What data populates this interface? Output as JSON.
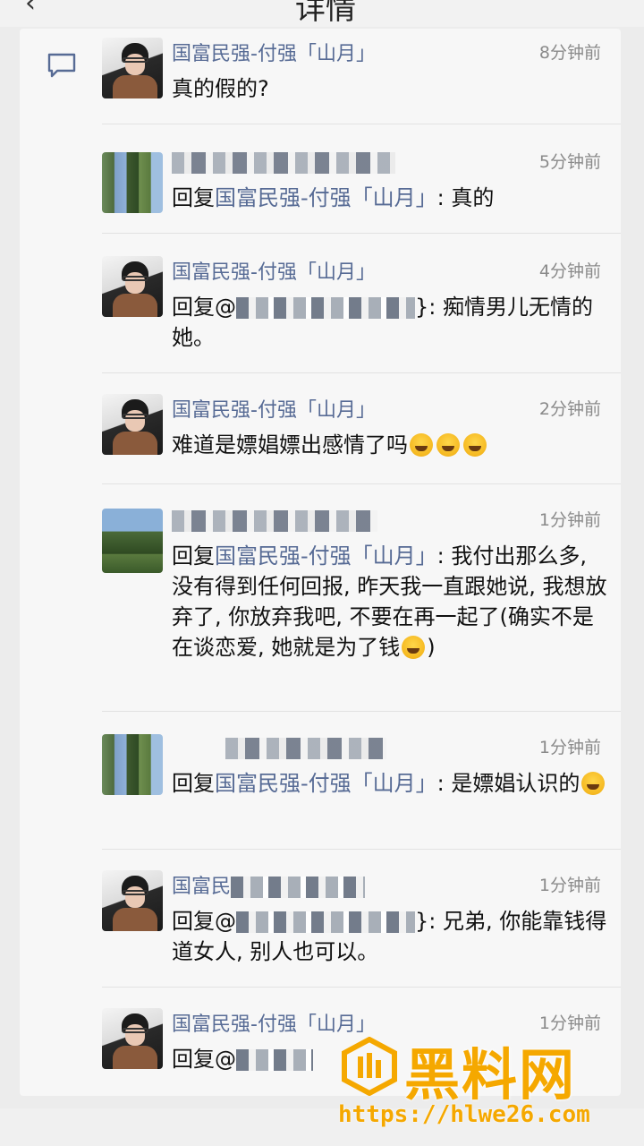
{
  "header": {
    "back_icon": "chevron-left-icon",
    "title": "详情"
  },
  "comments": [
    {
      "author": "国富民强-付强「山月」",
      "time": "8分钟前",
      "text": "真的假的?",
      "avatar": "person-avatar"
    },
    {
      "author": "",
      "time": "5分钟前",
      "reply_prefix": "回复",
      "reply_target": "国富民强-付强「山月」",
      "text": ": 真的",
      "avatar": "blurred-avatar"
    },
    {
      "author": "国富民强-付强「山月」",
      "time": "4分钟前",
      "reply_prefix": "回复@",
      "text": "}: 痴情男儿无情的她。",
      "avatar": "person-avatar"
    },
    {
      "author": "国富民强-付强「山月」",
      "time": "2分钟前",
      "text": "难道是嫖娼嫖出感情了吗",
      "avatar": "person-avatar"
    },
    {
      "author": "",
      "time": "1分钟前",
      "reply_prefix": "回复",
      "reply_target": "国富民强-付强「山月」",
      "text": ": 我付出那么多, 没有得到任何回报, 昨天我一直跟她说, 我想放弃了, 你放弃我吧, 不要在再一起了(确实不是在谈恋爱, 她就是为了钱",
      "text_end": ")",
      "avatar": "blurred-avatar"
    },
    {
      "author": "",
      "time": "1分钟前",
      "reply_prefix": "回复",
      "reply_target": "国富民强-付强「山月」",
      "text": ": 是嫖娼认识的",
      "avatar": "blurred-avatar"
    },
    {
      "author": "国富民",
      "time": "1分钟前",
      "reply_prefix": "回复@",
      "text": "}: 兄弟, 你能靠钱得道女人, 别人也可以。",
      "avatar": "person-avatar"
    },
    {
      "author": "国富民强-付强「山月」",
      "time": "1分钟前",
      "reply_prefix": "回复@",
      "text": "",
      "avatar": "person-avatar"
    }
  ],
  "watermark": {
    "brand": "黑料网",
    "url": "https://hlwe26.com"
  },
  "colors": {
    "link": "#576b95",
    "watermark": "#f5a800"
  }
}
